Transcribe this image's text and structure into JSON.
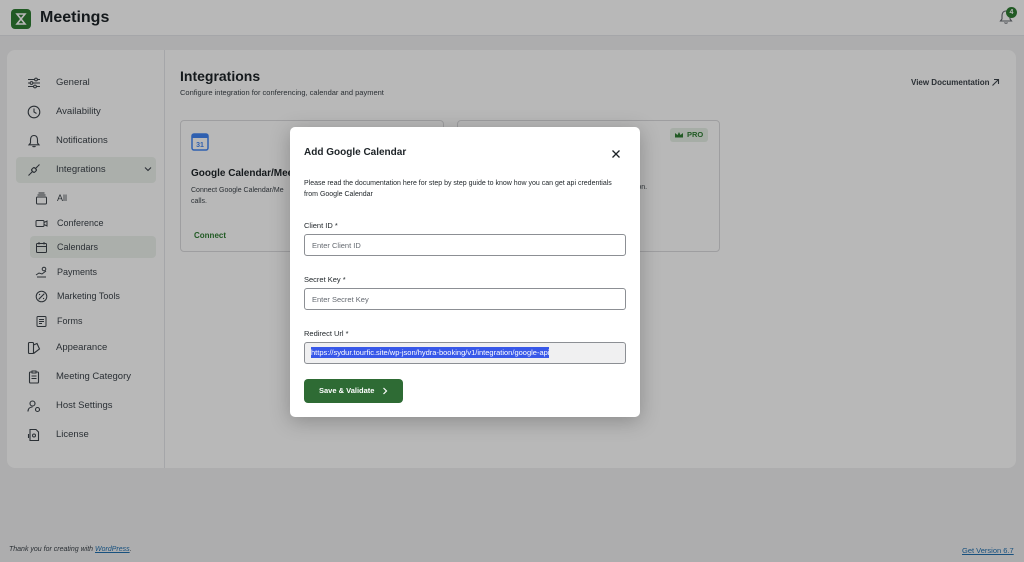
{
  "header": {
    "title": "Meetings",
    "notification_count": "4"
  },
  "sidebar": {
    "items": [
      {
        "label": "General",
        "icon": "sliders-icon"
      },
      {
        "label": "Availability",
        "icon": "clock-icon"
      },
      {
        "label": "Notifications",
        "icon": "bell-icon"
      },
      {
        "label": "Integrations",
        "icon": "integration-icon"
      },
      {
        "label": "Appearance",
        "icon": "palette-icon"
      },
      {
        "label": "Meeting Category",
        "icon": "clipboard-icon"
      },
      {
        "label": "Host Settings",
        "icon": "user-gear-icon"
      },
      {
        "label": "License",
        "icon": "license-icon"
      }
    ],
    "subitems": [
      {
        "label": "All",
        "icon": "stack-icon"
      },
      {
        "label": "Conference",
        "icon": "video-icon"
      },
      {
        "label": "Calendars",
        "icon": "calendar-icon"
      },
      {
        "label": "Payments",
        "icon": "payment-icon"
      },
      {
        "label": "Marketing Tools",
        "icon": "marketing-icon"
      },
      {
        "label": "Forms",
        "icon": "form-icon"
      }
    ]
  },
  "main": {
    "title": "Integrations",
    "subtitle": "Configure integration for conferencing, calendar and payment",
    "view_documentation": "View Documentation",
    "cards": [
      {
        "title": "Google Calendar/Mee",
        "description": "Connect Google Calendar/Me calls.",
        "action": "Connect"
      },
      {
        "badge": "PRO",
        "description": "ation."
      }
    ]
  },
  "modal": {
    "title": "Add Google Calendar",
    "description": "Please read the documentation here for step by step guide to know how you can get api credentials from Google Calendar",
    "client_id": {
      "label": "Client ID *",
      "placeholder": "Enter Client ID"
    },
    "secret_key": {
      "label": "Secret Key *",
      "placeholder": "Enter Secret Key"
    },
    "redirect_url": {
      "label": "Redirect Url *",
      "value": "https://sydur.tourfic.site/wp-json/hydra-booking/v1/integration/google-api"
    },
    "save_label": "Save & Validate"
  },
  "footer": {
    "left_text": "Thank you for creating with ",
    "left_link": "WordPress",
    "left_suffix": ".",
    "version": "Get Version 6.7"
  },
  "colors": {
    "brand": "#2e7d32",
    "button": "#2e6b34",
    "link": "#2271b1",
    "selection": "#3858e9"
  }
}
